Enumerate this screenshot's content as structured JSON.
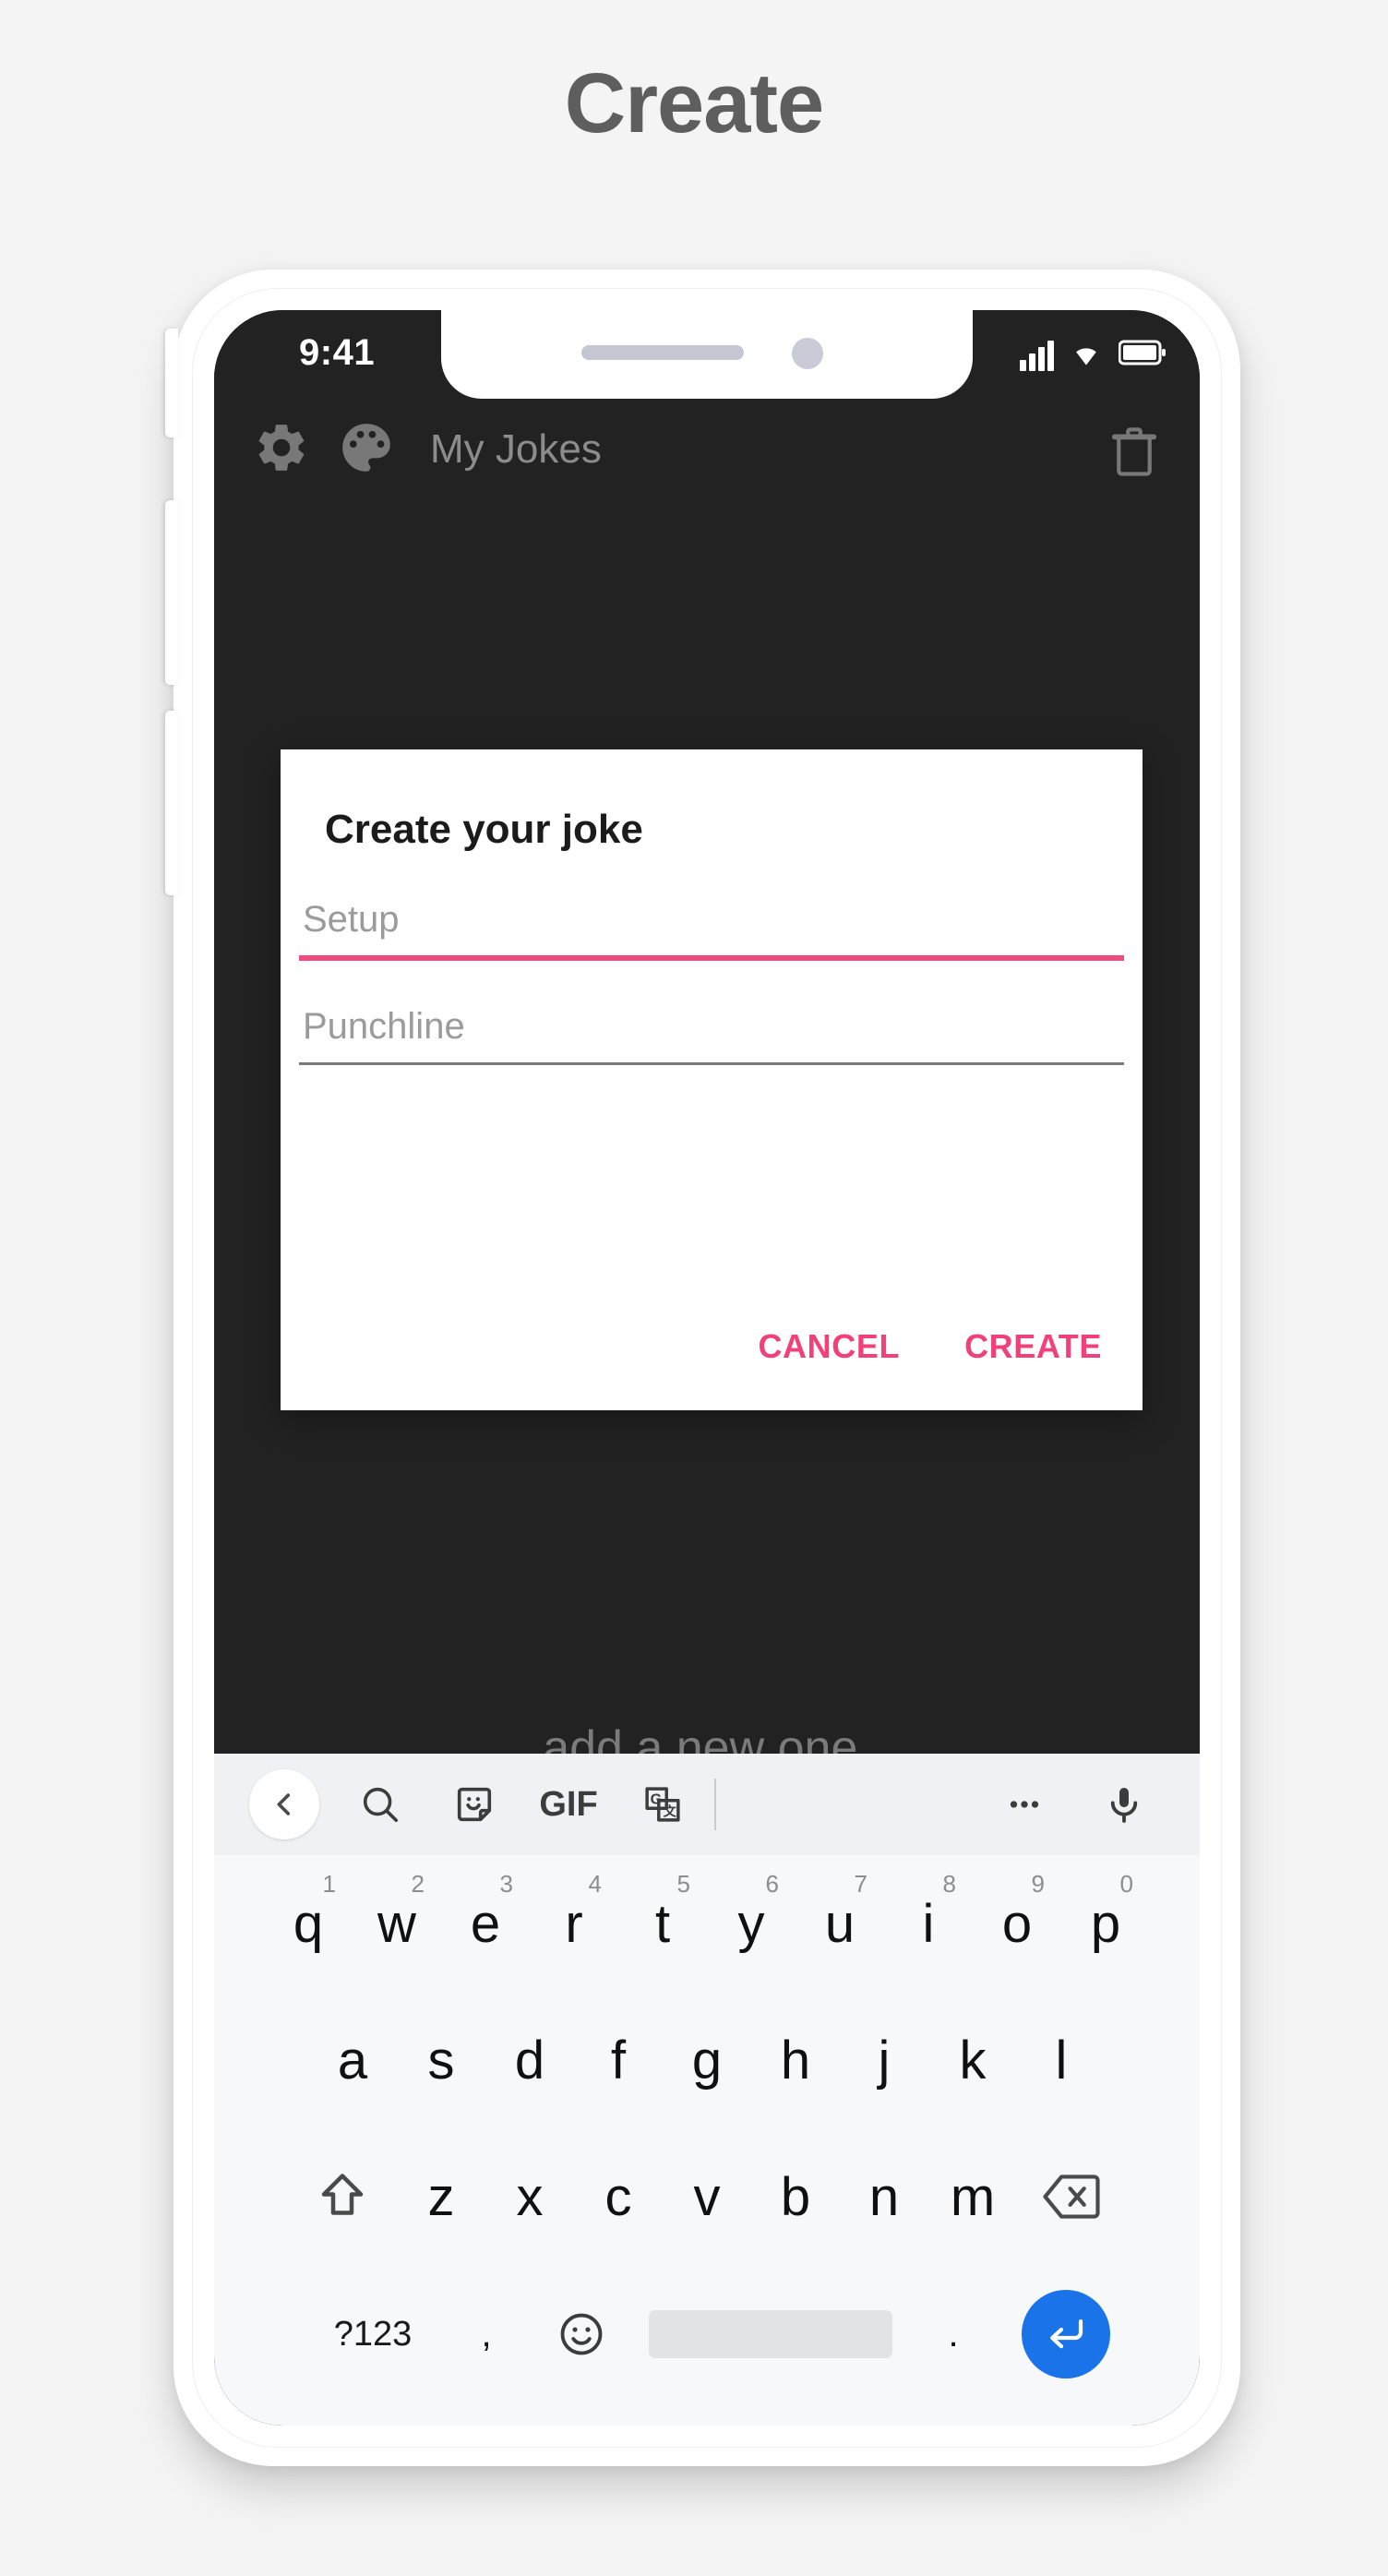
{
  "page": {
    "title": "Create",
    "title_color": "#5e5e5e",
    "background_color": "#f4f4f4"
  },
  "accent_color": "#f2407a",
  "status_bar": {
    "time": "9:41",
    "icons": [
      "signal-icon",
      "wifi-icon",
      "battery-icon"
    ]
  },
  "app_bar": {
    "title": "My Jokes",
    "left_icons": [
      "gear-icon",
      "palette-icon"
    ],
    "right_icons": [
      "trash-icon"
    ]
  },
  "screen": {
    "background_hint_text": "add a new one."
  },
  "dialog": {
    "title": "Create your joke",
    "fields": [
      {
        "name": "setup",
        "placeholder": "Setup",
        "value": "",
        "focused": true,
        "underline_color": "#f04a7e"
      },
      {
        "name": "punchline",
        "placeholder": "Punchline",
        "value": "",
        "focused": false,
        "underline_color": "#7a7a7a"
      }
    ],
    "actions": [
      {
        "name": "cancel",
        "label": "CANCEL"
      },
      {
        "name": "create",
        "label": "CREATE"
      }
    ]
  },
  "keyboard": {
    "toolbar": [
      {
        "name": "back-chevron-icon",
        "label": ""
      },
      {
        "name": "search-icon",
        "label": ""
      },
      {
        "name": "sticker-icon",
        "label": ""
      },
      {
        "name": "gif-icon",
        "label": "GIF"
      },
      {
        "name": "translate-icon",
        "label": ""
      },
      {
        "name": "more-icon",
        "label": ""
      },
      {
        "name": "microphone-icon",
        "label": ""
      }
    ],
    "row_top": [
      {
        "key": "q",
        "num": "1"
      },
      {
        "key": "w",
        "num": "2"
      },
      {
        "key": "e",
        "num": "3"
      },
      {
        "key": "r",
        "num": "4"
      },
      {
        "key": "t",
        "num": "5"
      },
      {
        "key": "y",
        "num": "6"
      },
      {
        "key": "u",
        "num": "7"
      },
      {
        "key": "i",
        "num": "8"
      },
      {
        "key": "o",
        "num": "9"
      },
      {
        "key": "p",
        "num": "0"
      }
    ],
    "row_middle": [
      "a",
      "s",
      "d",
      "f",
      "g",
      "h",
      "j",
      "k",
      "l"
    ],
    "row_lower": [
      "z",
      "x",
      "c",
      "v",
      "b",
      "n",
      "m"
    ],
    "shift_key": "shift-icon",
    "backspace_key": "backspace-icon",
    "row_bottom": {
      "symbols_label": "?123",
      "comma_label": ",",
      "emoji_icon": "emoji-icon",
      "space_label": "",
      "period_label": ".",
      "enter_icon": "enter-icon",
      "enter_color": "#1a73e8"
    }
  }
}
